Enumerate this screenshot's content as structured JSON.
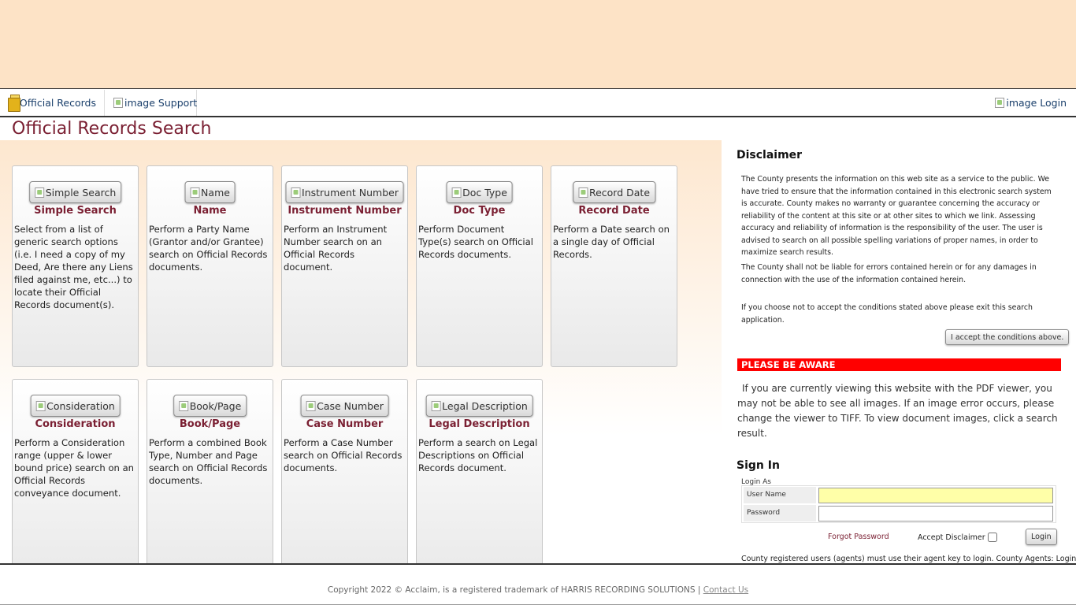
{
  "nav": {
    "official_records": "Official Records",
    "support": "image Support",
    "login": "image Login"
  },
  "page_title": "Official Records Search",
  "cards": [
    {
      "button": "Simple Search",
      "title": "Simple Search",
      "desc": "Select from a list of generic search options (i.e. I need a copy of my Deed, Are there any Liens filed against me, etc...) to locate their Official Records document(s)."
    },
    {
      "button": "Name",
      "title": "Name",
      "desc": "Perform a Party Name (Grantor and/or Grantee) search on Official Records documents."
    },
    {
      "button": "Instrument Number",
      "title": "Instrument Number",
      "desc": "Perform an Instrument Number search on an Official Records document."
    },
    {
      "button": "Doc Type",
      "title": "Doc Type",
      "desc": "Perform Document Type(s) search on Official Records documents."
    },
    {
      "button": "Record Date",
      "title": "Record Date",
      "desc": "Perform a Date search on a single day of Official Records."
    },
    {
      "button": "Consideration",
      "title": "Consideration",
      "desc": "Perform a Consideration range (upper & lower bound price) search on an Official Records conveyance document."
    },
    {
      "button": "Book/Page",
      "title": "Book/Page",
      "desc": "Perform a combined Book Type, Number and Page search on Official Records documents."
    },
    {
      "button": "Case Number",
      "title": "Case Number",
      "desc": "Perform a Case Number search on Official Records documents."
    },
    {
      "button": "Legal Description",
      "title": "Legal Description",
      "desc": "Perform a search on Legal Descriptions on Official Records document."
    }
  ],
  "disclaimer": {
    "title": "Disclaimer",
    "p1": "The County presents the information on this web site as a service to the public. We have tried to ensure that the information contained in this electronic search system is accurate. County makes no warranty or guarantee concerning the accuracy or reliability of the content at this site or at other sites to which we link. Assessing accuracy and reliability of information is the responsibility of the user. The user is advised to search on all possible spelling variations of proper names, in order to maximize search results.",
    "p2": "The County shall not be liable for errors contained herein or for any damages in connection with the use of the information contained herein.",
    "p3": "If you choose not to accept the conditions stated above please exit this search application.",
    "accept_button": "I accept the conditions above."
  },
  "aware": {
    "title": "PLEASE BE AWARE",
    "text": "If you are currently viewing this website with the PDF viewer, you may not be able to see all images. If an image error occurs, please change the viewer to TIFF. To view document images, click a search result."
  },
  "signin": {
    "title": "Sign In",
    "login_as": "Login As",
    "username_label": "User Name",
    "password_label": "Password",
    "forgot": "Forgot Password",
    "accept_disclaimer": "Accept Disclaimer",
    "login_button": "Login",
    "agent_note": "County registered users (agents) must use their agent key to login. County Agents: Login"
  },
  "footer": {
    "copyright": "Copyright 2022 © Acclaim, is a registered trademark of HARRIS RECORDING SOLUTIONS |",
    "contact": "Contact Us"
  }
}
